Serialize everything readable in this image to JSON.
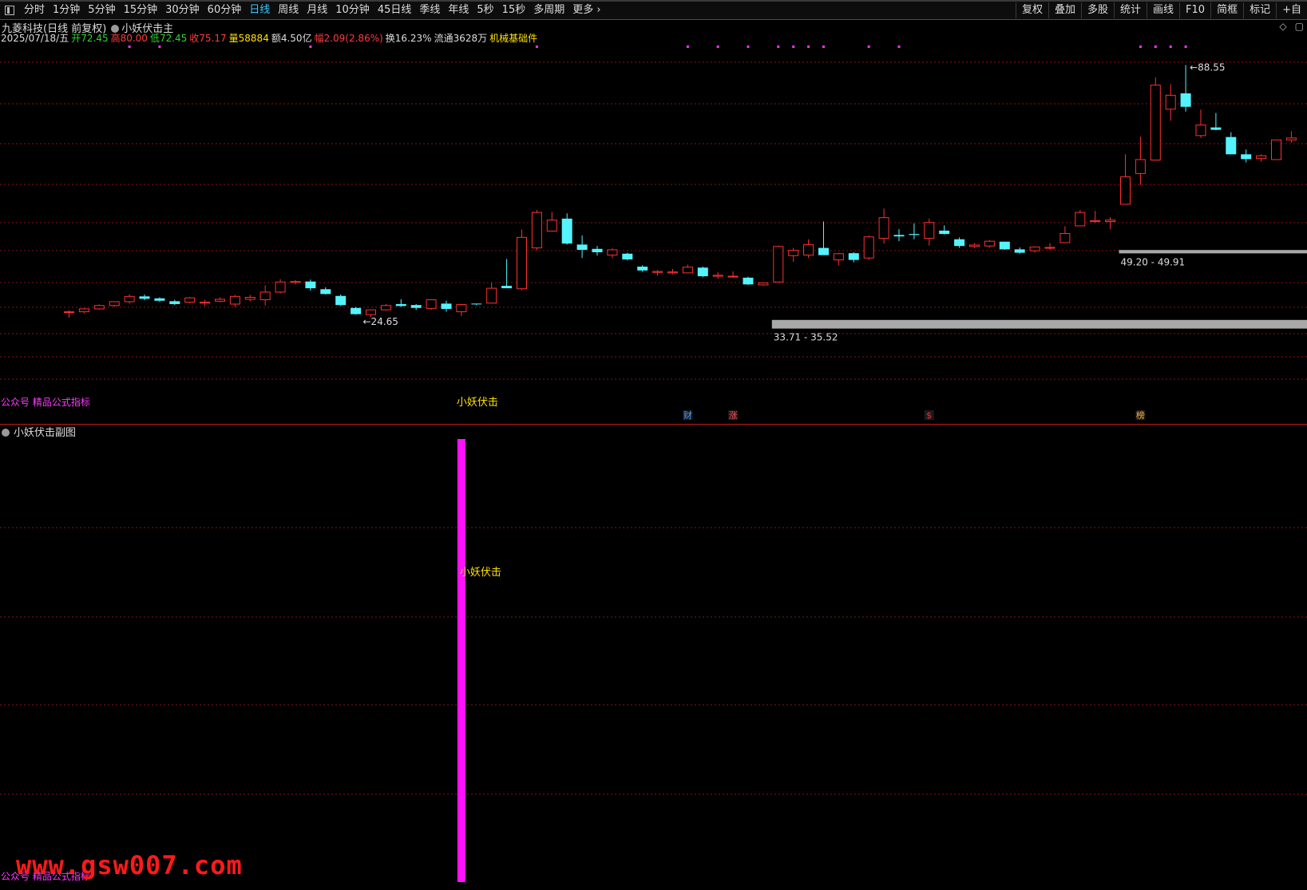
{
  "toolbar": {
    "periods": [
      "分时",
      "1分钟",
      "5分钟",
      "15分钟",
      "30分钟",
      "60分钟",
      "日线",
      "周线",
      "月线",
      "10分钟",
      "45日线",
      "季线",
      "年线",
      "5秒",
      "15秒",
      "多周期",
      "更多"
    ],
    "active_period": "日线",
    "buttons": [
      "复权",
      "叠加",
      "多股",
      "统计",
      "画线",
      "F10",
      "简框",
      "标记",
      "+自"
    ]
  },
  "stock": {
    "title": "九菱科技(日线 前复权)",
    "indicator_main": "小妖伏击主",
    "date": "2025/07/18/五",
    "open": "开72.45",
    "high": "高80.00",
    "low": "低72.45",
    "close": "收75.17",
    "volume": "量58884",
    "amount": "额4.50亿",
    "change": "幅2.09(2.86%)",
    "turnover": "换16.23%",
    "float": "流通3628万",
    "sector": "机械基础件"
  },
  "corner_icons": [
    "diamond-icon",
    "square-icon"
  ],
  "annotations": {
    "high_label": "88.55",
    "low_label": "24.65",
    "zone_low": "33.71 - 35.52",
    "zone_high": "49.20 - 49.91",
    "signal_main": "小妖伏击",
    "signal_sub": "小妖伏击",
    "events": [
      "财",
      "涨",
      "$",
      "榜"
    ]
  },
  "footer_labels": {
    "main": "公众号 精品公式指标",
    "sub": "公众号 精品公式指标"
  },
  "sub_panel": {
    "title": "小妖伏击副图"
  },
  "watermark": "www.gsw007.com",
  "colors": {
    "up": "#ff3030",
    "down": "#54f4ff",
    "grid": "#8a1414",
    "zone": "#a8a8a8",
    "signal_bar": "#ff10ff",
    "marker": "#ff30ff"
  },
  "chart_data": {
    "type": "candlestick",
    "ylim": [
      22,
      92
    ],
    "candles": [
      [
        37.1,
        37.5,
        36.0,
        37.2
      ],
      [
        37.2,
        38.0,
        36.9,
        37.8
      ],
      [
        37.8,
        38.7,
        37.6,
        38.5
      ],
      [
        38.5,
        39.4,
        38.2,
        39.3
      ],
      [
        39.3,
        40.8,
        38.9,
        40.4
      ],
      [
        40.4,
        40.8,
        39.6,
        39.9
      ],
      [
        40.0,
        40.2,
        39.3,
        39.5
      ],
      [
        39.4,
        39.7,
        38.6,
        38.8
      ],
      [
        39.2,
        40.3,
        39.0,
        40.1
      ],
      [
        39.0,
        39.7,
        38.4,
        39.2
      ],
      [
        39.4,
        40.2,
        39.2,
        39.8
      ],
      [
        38.8,
        40.7,
        38.2,
        40.4
      ],
      [
        39.8,
        40.7,
        39.4,
        40.2
      ],
      [
        39.7,
        42.7,
        38.5,
        41.3
      ],
      [
        41.3,
        44.0,
        41.0,
        43.4
      ],
      [
        43.3,
        43.8,
        42.9,
        43.5
      ],
      [
        43.5,
        43.9,
        41.6,
        42.1
      ],
      [
        41.9,
        42.3,
        40.8,
        40.9
      ],
      [
        40.5,
        40.8,
        38.4,
        38.6
      ],
      [
        38.0,
        38.2,
        36.6,
        36.7
      ],
      [
        36.6,
        37.7,
        36.1,
        37.6
      ],
      [
        37.6,
        38.8,
        37.6,
        38.5
      ],
      [
        38.8,
        39.8,
        38.2,
        38.4
      ],
      [
        38.6,
        38.8,
        37.6,
        38.0
      ],
      [
        37.9,
        39.8,
        37.6,
        39.7
      ],
      [
        38.9,
        39.5,
        37.2,
        37.8
      ],
      [
        37.2,
        38.8,
        36.3,
        38.7
      ],
      [
        38.9,
        38.9,
        38.6,
        38.8
      ],
      [
        39.0,
        43.3,
        39.0,
        42.1
      ],
      [
        42.6,
        48.2,
        42.4,
        42.1
      ],
      [
        42.0,
        54.3,
        41.7,
        52.7
      ],
      [
        50.5,
        58.4,
        50.0,
        57.9
      ],
      [
        54.0,
        58.0,
        54.0,
        56.3
      ],
      [
        56.6,
        57.7,
        51.2,
        51.4
      ],
      [
        51.2,
        53.1,
        48.4,
        50.1
      ],
      [
        50.3,
        50.9,
        48.9,
        49.6
      ],
      [
        49.0,
        50.4,
        48.4,
        50.1
      ],
      [
        49.3,
        49.5,
        47.9,
        48.1
      ],
      [
        46.6,
        46.9,
        45.5,
        45.8
      ],
      [
        45.4,
        45.9,
        44.7,
        45.6
      ],
      [
        45.3,
        46.1,
        45.0,
        45.5
      ],
      [
        45.3,
        47.0,
        45.2,
        46.5
      ],
      [
        46.4,
        46.6,
        44.4,
        44.6
      ],
      [
        44.6,
        45.5,
        44.1,
        44.8
      ],
      [
        44.5,
        45.6,
        44.3,
        44.6
      ],
      [
        44.3,
        44.5,
        42.8,
        42.9
      ],
      [
        42.8,
        43.2,
        42.6,
        43.2
      ],
      [
        43.4,
        51.0,
        43.4,
        50.8
      ],
      [
        48.9,
        50.5,
        47.6,
        50.0
      ],
      [
        49.0,
        52.3,
        48.4,
        51.2
      ],
      [
        50.5,
        56.0,
        49.4,
        49.0
      ],
      [
        48.0,
        49.5,
        46.9,
        49.3
      ],
      [
        49.4,
        49.6,
        47.5,
        48.0
      ],
      [
        48.4,
        53.1,
        48.0,
        52.8
      ],
      [
        52.5,
        58.7,
        51.4,
        56.8
      ],
      [
        53.2,
        54.4,
        51.9,
        52.9
      ],
      [
        53.4,
        55.6,
        52.3,
        53.2
      ],
      [
        52.5,
        56.6,
        51.0,
        55.8
      ],
      [
        54.1,
        55.2,
        53.3,
        53.4
      ],
      [
        52.3,
        52.7,
        50.5,
        50.9
      ],
      [
        50.8,
        51.5,
        50.5,
        51.1
      ],
      [
        50.9,
        52.1,
        50.6,
        51.9
      ],
      [
        51.8,
        51.8,
        50.1,
        50.2
      ],
      [
        50.2,
        50.6,
        49.3,
        49.5
      ],
      [
        49.9,
        50.7,
        49.5,
        50.7
      ],
      [
        50.6,
        51.5,
        50.1,
        50.6
      ],
      [
        51.6,
        55.0,
        51.6,
        53.5
      ],
      [
        55.1,
        58.4,
        55.1,
        57.9
      ],
      [
        56.0,
        58.2,
        55.7,
        56.2
      ],
      [
        56.0,
        56.9,
        54.4,
        56.3
      ],
      [
        59.6,
        70.0,
        59.6,
        65.3
      ],
      [
        66.0,
        73.7,
        63.6,
        68.9
      ],
      [
        68.8,
        86.0,
        68.8,
        84.4
      ],
      [
        79.4,
        84.6,
        77.0,
        82.3
      ],
      [
        82.7,
        88.6,
        78.9,
        79.9
      ],
      [
        73.9,
        79.3,
        73.4,
        76.1
      ],
      [
        75.6,
        78.6,
        75.0,
        75.1
      ],
      [
        73.6,
        74.6,
        70.0,
        70.0
      ],
      [
        70.0,
        71.0,
        68.3,
        69.0
      ],
      [
        69.1,
        70.0,
        68.5,
        69.7
      ],
      [
        68.9,
        72.9,
        68.9,
        73.0
      ],
      [
        73.0,
        74.8,
        72.4,
        73.4
      ]
    ],
    "signals": [
      26
    ],
    "marker_dots": [
      4,
      6,
      16,
      31,
      41,
      43,
      45,
      47,
      48,
      49,
      50,
      53,
      55,
      71,
      72,
      73,
      74
    ]
  }
}
